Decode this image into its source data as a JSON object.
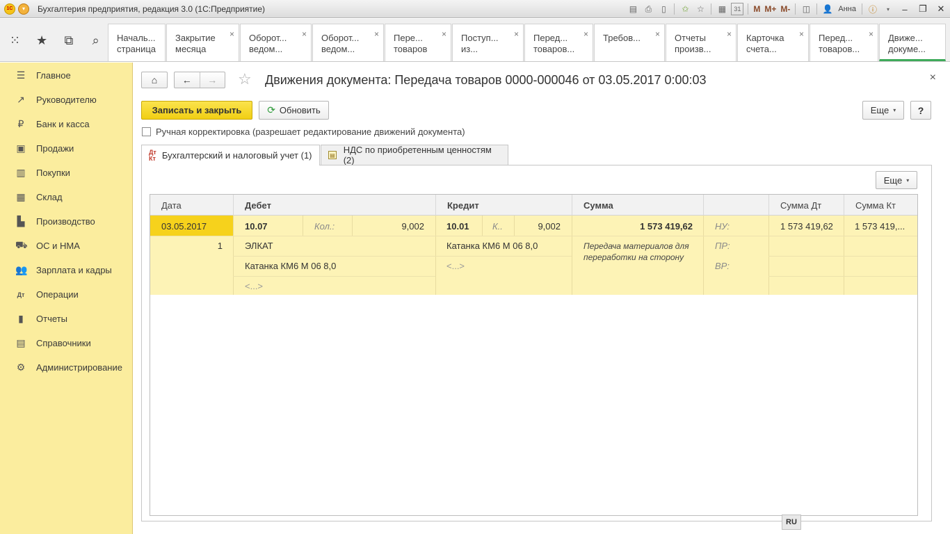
{
  "window": {
    "title": "Бухгалтерия предприятия, редакция 3.0 (1С:Предприятие)",
    "logo_text": "1С",
    "user": "Анна",
    "m_labels": [
      "M",
      "M+",
      "M-"
    ],
    "icons": [
      "compare-icon",
      "print-icon",
      "preview-icon",
      "favorites-icon",
      "star-icon",
      "calculator-icon",
      "calendar-icon",
      "panel-icon",
      "info-icon",
      "minimize-icon",
      "restore-icon",
      "close-icon"
    ]
  },
  "tabbar": {
    "tools": [
      "apps-icon",
      "star-icon",
      "history-icon",
      "search-icon"
    ],
    "tabs": [
      {
        "l1": "Началь...",
        "l2": "страница",
        "closable": false
      },
      {
        "l1": "Закрытие",
        "l2": "месяца",
        "closable": true
      },
      {
        "l1": "Оборот...",
        "l2": "ведом...",
        "closable": true
      },
      {
        "l1": "Оборот...",
        "l2": "ведом...",
        "closable": true
      },
      {
        "l1": "Пере...",
        "l2": "товаров",
        "closable": true
      },
      {
        "l1": "Поступ...",
        "l2": "из...",
        "closable": true
      },
      {
        "l1": "Перед...",
        "l2": "товаров...",
        "closable": true
      },
      {
        "l1": "Требов...",
        "l2": "",
        "closable": true
      },
      {
        "l1": "Отчеты",
        "l2": "произв...",
        "closable": true
      },
      {
        "l1": "Карточка",
        "l2": "счета...",
        "closable": true
      },
      {
        "l1": "Перед...",
        "l2": "товаров...",
        "closable": true
      },
      {
        "l1": "Движе...",
        "l2": "докуме...",
        "closable": false
      }
    ],
    "close_glyph": "×"
  },
  "sidebar": {
    "items": [
      {
        "label": "Главное",
        "icon": "menu-icon"
      },
      {
        "label": "Руководителю",
        "icon": "trend-icon"
      },
      {
        "label": "Банк и касса",
        "icon": "ruble-icon"
      },
      {
        "label": "Продажи",
        "icon": "bag-icon"
      },
      {
        "label": "Покупки",
        "icon": "cart-icon"
      },
      {
        "label": "Склад",
        "icon": "warehouse-icon"
      },
      {
        "label": "Производство",
        "icon": "factory-icon"
      },
      {
        "label": "ОС и НМА",
        "icon": "truck-icon"
      },
      {
        "label": "Зарплата и кадры",
        "icon": "people-icon"
      },
      {
        "label": "Операции",
        "icon": "dt-kt-icon"
      },
      {
        "label": "Отчеты",
        "icon": "chart-icon"
      },
      {
        "label": "Справочники",
        "icon": "book-icon"
      },
      {
        "label": "Администрирование",
        "icon": "gear-icon"
      }
    ]
  },
  "main": {
    "title": "Движения документа: Передача товаров 0000-000046 от 03.05.2017 0:00:03",
    "save_label": "Записать и закрыть",
    "refresh_label": "Обновить",
    "more_label": "Еще",
    "help_label": "?",
    "close_glyph": "×",
    "manual_label": "Ручная корректировка (разрешает редактирование движений документа)",
    "manual_checked": false,
    "page_tabs": [
      {
        "label": "Бухгалтерский и налоговый учет (1)",
        "icon_text": "Дт Кт",
        "active": true
      },
      {
        "label": "НДС по приобретенным ценностям (2)",
        "icon_text": "",
        "active": false
      }
    ]
  },
  "grid": {
    "more_label": "Еще",
    "columns": [
      "Дата",
      "Дебет",
      "Кредит",
      "Сумма",
      "",
      "Сумма Дт",
      "Сумма Кт"
    ],
    "row": {
      "date": "03.05.2017",
      "number": "1",
      "debit_account": "10.07",
      "debit_qty_label": "Кол.:",
      "debit_qty": "9,002",
      "debit_sub1": "ЭЛКАТ",
      "debit_sub2": "Катанка КМ6 М 06 8,0",
      "debit_sub3": "<...>",
      "credit_account": "10.01",
      "credit_qty_label": "К..",
      "credit_qty": "9,002",
      "credit_sub1": "Катанка КМ6 М 06 8,0",
      "credit_sub2": "<...>",
      "amount": "1 573 419,62",
      "description": "Передача материалов для переработки на сторону",
      "nu_label": "НУ:",
      "pr_label": "ПР:",
      "vr_label": "ВР:",
      "sum_dt": "1 573 419,62",
      "sum_kt": "1 573 419,..."
    }
  },
  "status": {
    "lang": "RU"
  }
}
